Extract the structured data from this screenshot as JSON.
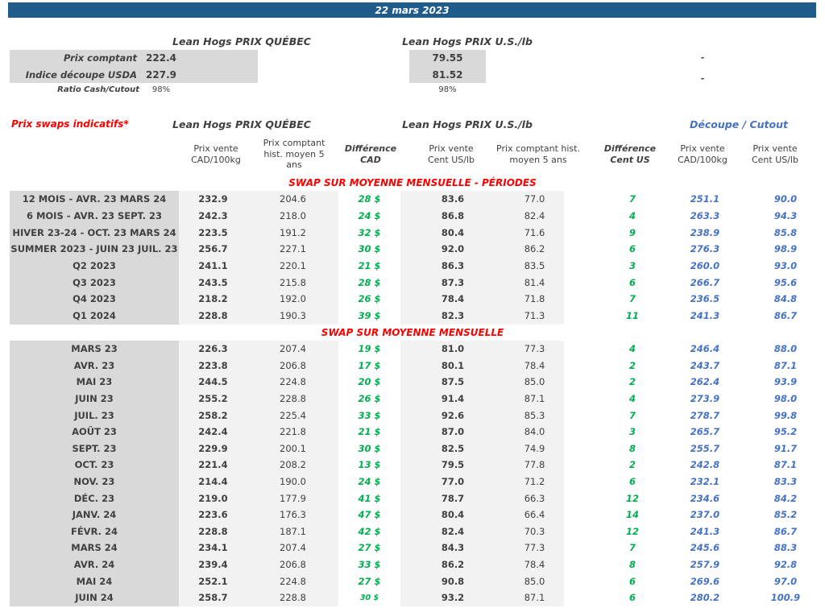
{
  "title_bar": {
    "date": "22 mars 2023"
  },
  "colors": {
    "banner_blue": "#1F5C8C",
    "accent_blue": "#4472C4",
    "accent_green": "#00B050",
    "accent_red": "#FF0000",
    "label_gray_bg": "#D9D9D9",
    "cell_gray_bg": "#F2F2F2"
  },
  "spot": {
    "quebec_header": "Lean Hogs PRIX QUÉBEC",
    "us_header": "Lean Hogs PRIX U.S./lb",
    "rows": [
      {
        "label": "Prix comptant",
        "quebec": "222.4",
        "us": "79.55",
        "right": "-"
      },
      {
        "label": "Indice découpe USDA",
        "quebec": "227.9",
        "us": "81.52",
        "right": "-"
      }
    ],
    "ratio": {
      "label": "Ratio Cash/Cutout",
      "quebec": "98%",
      "us": "98%"
    }
  },
  "swaps": {
    "title": "Prix swaps indicatifs*",
    "quebec_header": "Lean Hogs PRIX QUÉBEC",
    "us_header": "Lean Hogs PRIX U.S./lb",
    "cutout_header": "Découpe / Cutout",
    "columns": [
      "Prix vente\nCAD/100kg",
      "Prix comptant\nhist. moyen 5\nans",
      "Différence\nCAD",
      "Prix vente\nCent US/lb",
      "Prix comptant hist.\nmoyen 5 ans",
      "Différence\nCent US",
      "Prix vente\nCAD/100kg",
      "Prix vente\nCent US/lb"
    ],
    "sections": [
      {
        "title": "SWAP SUR MOYENNE MENSUELLE - PÉRIODES",
        "rows": [
          {
            "label": "12 MOIS - AVR. 23 MARS 24",
            "cad_vente": "232.9",
            "cad_hist": "204.6",
            "diff_cad": "28 $",
            "us_vente": "83.6",
            "us_hist": "77.0",
            "diff_us": "7",
            "cutout_cad": "251.1",
            "cutout_us": "90.0"
          },
          {
            "label": "6 MOIS - AVR. 23 SEPT. 23",
            "cad_vente": "242.3",
            "cad_hist": "218.0",
            "diff_cad": "24 $",
            "us_vente": "86.8",
            "us_hist": "82.4",
            "diff_us": "4",
            "cutout_cad": "263.3",
            "cutout_us": "94.3"
          },
          {
            "label": "HIVER 23-24 -  OCT. 23 MARS 24",
            "cad_vente": "223.5",
            "cad_hist": "191.2",
            "diff_cad": "32 $",
            "us_vente": "80.4",
            "us_hist": "71.6",
            "diff_us": "9",
            "cutout_cad": "238.9",
            "cutout_us": "85.8"
          },
          {
            "label": "SUMMER 2023 - JUIN 23 JUIL. 23",
            "cad_vente": "256.7",
            "cad_hist": "227.1",
            "diff_cad": "30 $",
            "us_vente": "92.0",
            "us_hist": "86.2",
            "diff_us": "6",
            "cutout_cad": "276.3",
            "cutout_us": "98.9"
          },
          {
            "label": "Q2 2023",
            "cad_vente": "241.1",
            "cad_hist": "220.1",
            "diff_cad": "21 $",
            "us_vente": "86.3",
            "us_hist": "83.5",
            "diff_us": "3",
            "cutout_cad": "260.0",
            "cutout_us": "93.0"
          },
          {
            "label": "Q3 2023",
            "cad_vente": "243.5",
            "cad_hist": "215.8",
            "diff_cad": "28 $",
            "us_vente": "87.3",
            "us_hist": "81.4",
            "diff_us": "6",
            "cutout_cad": "266.7",
            "cutout_us": "95.6"
          },
          {
            "label": "Q4 2023",
            "cad_vente": "218.2",
            "cad_hist": "192.0",
            "diff_cad": "26 $",
            "us_vente": "78.4",
            "us_hist": "71.8",
            "diff_us": "7",
            "cutout_cad": "236.5",
            "cutout_us": "84.8"
          },
          {
            "label": "Q1 2024",
            "cad_vente": "228.8",
            "cad_hist": "190.3",
            "diff_cad": "39 $",
            "us_vente": "82.3",
            "us_hist": "71.3",
            "diff_us": "11",
            "cutout_cad": "241.3",
            "cutout_us": "86.7"
          }
        ]
      },
      {
        "title": "SWAP SUR MOYENNE MENSUELLE",
        "rows": [
          {
            "label": "MARS 23",
            "cad_vente": "226.3",
            "cad_hist": "207.4",
            "diff_cad": "19 $",
            "us_vente": "81.0",
            "us_hist": "77.3",
            "diff_us": "4",
            "cutout_cad": "246.4",
            "cutout_us": "88.0"
          },
          {
            "label": "AVR. 23",
            "cad_vente": "223.8",
            "cad_hist": "206.8",
            "diff_cad": "17 $",
            "us_vente": "80.1",
            "us_hist": "78.4",
            "diff_us": "2",
            "cutout_cad": "243.7",
            "cutout_us": "87.1"
          },
          {
            "label": "MAI 23",
            "cad_vente": "244.5",
            "cad_hist": "224.8",
            "diff_cad": "20 $",
            "us_vente": "87.5",
            "us_hist": "85.0",
            "diff_us": "2",
            "cutout_cad": "262.4",
            "cutout_us": "93.9"
          },
          {
            "label": "JUIN 23",
            "cad_vente": "255.2",
            "cad_hist": "228.8",
            "diff_cad": "26 $",
            "us_vente": "91.4",
            "us_hist": "87.1",
            "diff_us": "4",
            "cutout_cad": "273.9",
            "cutout_us": "98.0"
          },
          {
            "label": "JUIL. 23",
            "cad_vente": "258.2",
            "cad_hist": "225.4",
            "diff_cad": "33 $",
            "us_vente": "92.6",
            "us_hist": "85.3",
            "diff_us": "7",
            "cutout_cad": "278.7",
            "cutout_us": "99.8"
          },
          {
            "label": "AOÛT 23",
            "cad_vente": "242.4",
            "cad_hist": "221.8",
            "diff_cad": "21 $",
            "us_vente": "87.0",
            "us_hist": "84.0",
            "diff_us": "3",
            "cutout_cad": "265.7",
            "cutout_us": "95.2"
          },
          {
            "label": "SEPT. 23",
            "cad_vente": "229.9",
            "cad_hist": "200.1",
            "diff_cad": "30 $",
            "us_vente": "82.5",
            "us_hist": "74.9",
            "diff_us": "8",
            "cutout_cad": "255.7",
            "cutout_us": "91.7"
          },
          {
            "label": "OCT. 23",
            "cad_vente": "221.4",
            "cad_hist": "208.2",
            "diff_cad": "13 $",
            "us_vente": "79.5",
            "us_hist": "77.8",
            "diff_us": "2",
            "cutout_cad": "242.8",
            "cutout_us": "87.1"
          },
          {
            "label": "NOV. 23",
            "cad_vente": "214.4",
            "cad_hist": "190.0",
            "diff_cad": "24 $",
            "us_vente": "77.0",
            "us_hist": "71.2",
            "diff_us": "6",
            "cutout_cad": "232.1",
            "cutout_us": "83.3"
          },
          {
            "label": "DÉC. 23",
            "cad_vente": "219.0",
            "cad_hist": "177.9",
            "diff_cad": "41 $",
            "us_vente": "78.7",
            "us_hist": "66.3",
            "diff_us": "12",
            "cutout_cad": "234.6",
            "cutout_us": "84.2"
          },
          {
            "label": "JANV. 24",
            "cad_vente": "223.6",
            "cad_hist": "176.3",
            "diff_cad": "47 $",
            "us_vente": "80.4",
            "us_hist": "66.4",
            "diff_us": "14",
            "cutout_cad": "237.0",
            "cutout_us": "85.2"
          },
          {
            "label": "FÉVR. 24",
            "cad_vente": "228.8",
            "cad_hist": "187.1",
            "diff_cad": "42 $",
            "us_vente": "82.4",
            "us_hist": "70.3",
            "diff_us": "12",
            "cutout_cad": "241.3",
            "cutout_us": "86.7"
          },
          {
            "label": "MARS 24",
            "cad_vente": "234.1",
            "cad_hist": "207.4",
            "diff_cad": "27 $",
            "us_vente": "84.3",
            "us_hist": "77.3",
            "diff_us": "7",
            "cutout_cad": "245.6",
            "cutout_us": "88.3"
          },
          {
            "label": "AVR. 24",
            "cad_vente": "239.4",
            "cad_hist": "206.8",
            "diff_cad": "33 $",
            "us_vente": "86.2",
            "us_hist": "78.4",
            "diff_us": "8",
            "cutout_cad": "257.9",
            "cutout_us": "92.8"
          },
          {
            "label": "MAI 24",
            "cad_vente": "252.1",
            "cad_hist": "224.8",
            "diff_cad": "27 $",
            "us_vente": "90.8",
            "us_hist": "85.0",
            "diff_us": "6",
            "cutout_cad": "269.6",
            "cutout_us": "97.0"
          },
          {
            "label": "JUIN 24",
            "cad_vente": "258.7",
            "cad_hist": "228.8",
            "diff_cad": "30 $",
            "us_vente": "93.2",
            "us_hist": "87.1",
            "diff_us": "6",
            "cutout_cad": "280.2",
            "cutout_us": "100.9",
            "small_diff": true
          }
        ]
      }
    ]
  }
}
